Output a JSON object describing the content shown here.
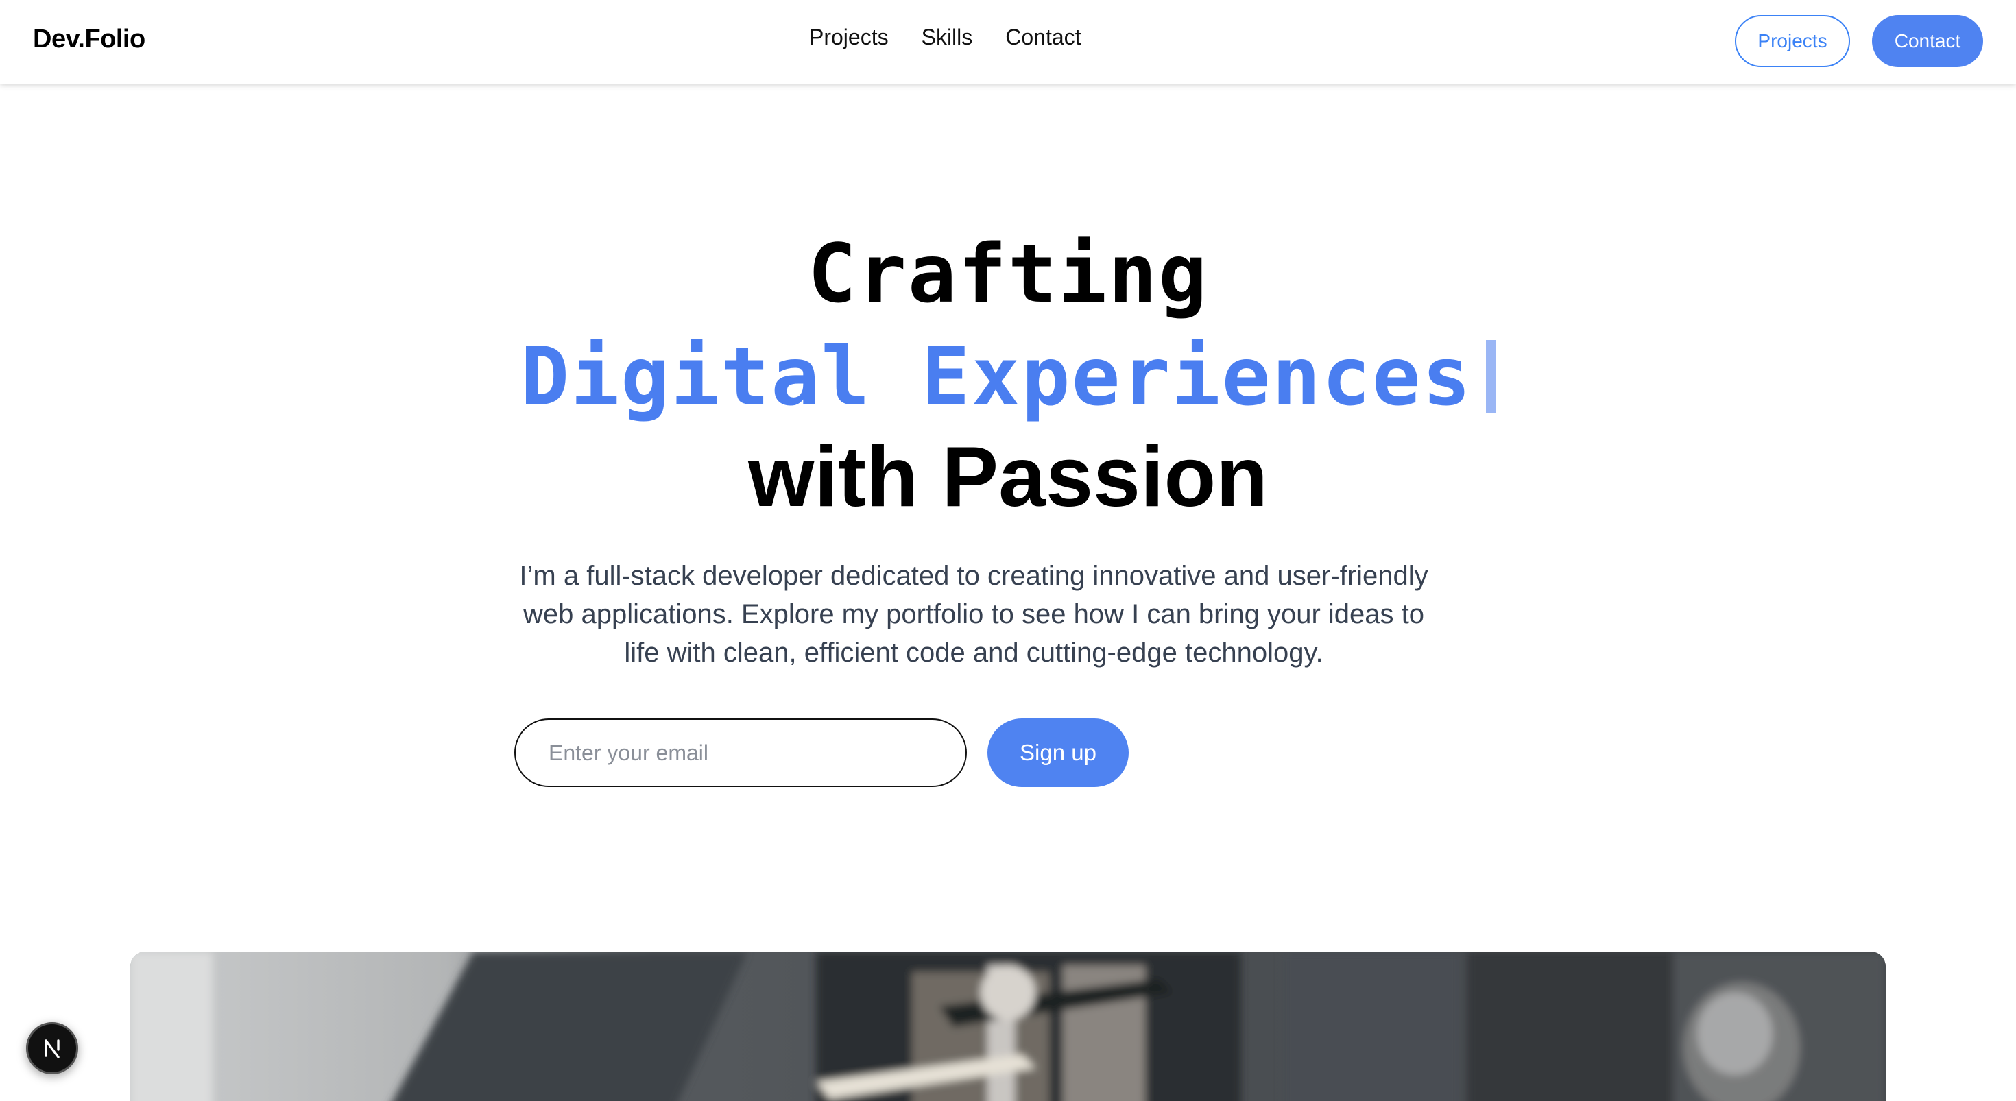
{
  "header": {
    "logo": "Dev.Folio",
    "nav": [
      "Projects",
      "Skills",
      "Contact"
    ],
    "projects_button": "Projects",
    "contact_button": "Contact"
  },
  "hero": {
    "line1": "Crafting",
    "line2": "Digital Experiences",
    "line3": "with Passion",
    "description": "I’m a full-stack developer dedicated to creating innovative and user-friendly web applications. Explore my portfolio to see how I can bring your ideas to life with clean, efficient code and cutting-edge technology."
  },
  "signup": {
    "email_placeholder": "Enter your email",
    "button_label": "Sign up"
  },
  "badge": {
    "letter": "N",
    "icon": "nextjs-icon"
  },
  "colors": {
    "accent": "#4f83f1",
    "accent_text": "#4a7ef0",
    "body_text": "#374151"
  }
}
